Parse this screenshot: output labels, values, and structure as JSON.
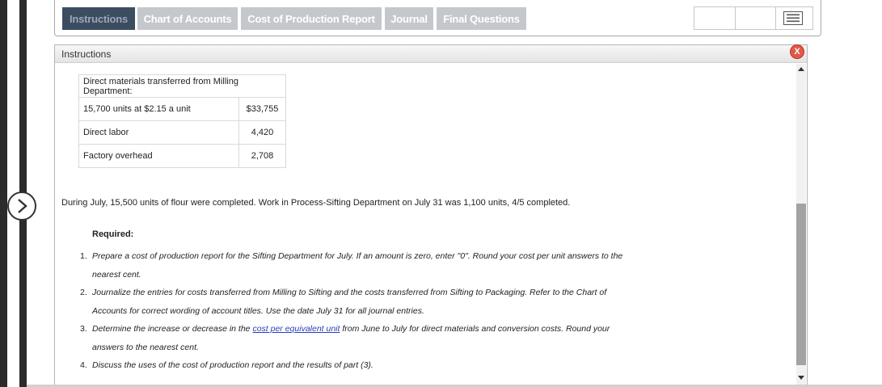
{
  "tabs": [
    {
      "label": "Instructions",
      "active": true
    },
    {
      "label": "Chart of Accounts",
      "active": false
    },
    {
      "label": "Cost of Production Report",
      "active": false
    },
    {
      "label": "Journal",
      "active": false
    },
    {
      "label": "Final Questions",
      "active": false
    }
  ],
  "panel": {
    "title": "Instructions",
    "close_label": "X"
  },
  "cost_table": {
    "header": "Direct materials transferred from Milling Department:",
    "rows": [
      {
        "label": "15,700 units at $2.15 a unit",
        "amount": "$33,755"
      },
      {
        "label": "Direct labor",
        "amount": "4,420"
      },
      {
        "label": "Factory overhead",
        "amount": "2,708"
      }
    ]
  },
  "paragraph": "During July, 15,500 units of flour were completed. Work in Process-Sifting Department on July 31 was 1,100 units, 4/5 completed.",
  "required_heading": "Required:",
  "requirements": [
    {
      "num": "1.",
      "line1": "Prepare a cost of production report for the Sifting Department for July. If an amount is zero, enter \"0\". Round your cost per unit answers to the",
      "line2": "nearest cent."
    },
    {
      "num": "2.",
      "line1": "Journalize the entries for costs transferred from Milling to Sifting and the costs transferred from Sifting to Packaging. Refer to the Chart of",
      "line2": "Accounts for correct wording of account titles. Use the date July 31 for all journal entries."
    },
    {
      "num": "3.",
      "pre": "Determine the increase or decrease in the ",
      "link": "cost per equivalent unit",
      "post": " from June to July for direct materials and conversion costs. Round your",
      "line2": "answers to the nearest cent."
    },
    {
      "num": "4.",
      "line1": "Discuss the uses of the cost of production report and the results of part (3)."
    }
  ],
  "colors": {
    "active_tab_bg": "#3c4d61",
    "inactive_tab_bg": "#c4c8cc",
    "close_button": "#e05a45",
    "link": "#2a3fb8"
  },
  "icons": {
    "nav": "chevron-right-icon",
    "menu": "menu-icon",
    "close": "close-icon"
  }
}
